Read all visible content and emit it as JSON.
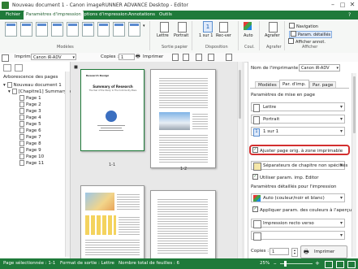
{
  "window": {
    "title": "Nouveau document 1 - Canon imageRUNNER ADVANCE Desktop - Editor"
  },
  "tabs": [
    {
      "label": "Fichier"
    },
    {
      "label": "Paramètres d'impression"
    },
    {
      "label": "Options d'impression"
    },
    {
      "label": "Annotations"
    },
    {
      "label": "Outils"
    }
  ],
  "ribbon": {
    "models_label": "Modèles",
    "sortie_papier_label": "Sortie papier",
    "disposition_label": "Disposition",
    "coul_label": "Coul.",
    "agrafer_group_label": "Agrafer",
    "afficher_label": "Afficher",
    "lettre": "Lettre",
    "portrait": "Portrait",
    "un_sur_un": "1 sur 1",
    "recto_verso": "Rec-ver",
    "auto": "Auto",
    "agrafer": "Agrafer",
    "navigation": "Navigation",
    "param_details": "Param. détaillés",
    "afficher_annot": "Afficher annot."
  },
  "toolbar": {
    "imprim_label": "Imprim :",
    "printer": "Canon iR-ADV",
    "copies_label": "Copies :",
    "copies_value": "1",
    "print_button": "Imprimer"
  },
  "tree": {
    "header": "Arborescence des pages",
    "root": "Nouveau document 1",
    "chapter": "[Chapitre1] Summary o",
    "pages": [
      "Page 1",
      "Page 2",
      "Page 3",
      "Page 4",
      "Page 5",
      "Page 6",
      "Page 7",
      "Page 8",
      "Page 9",
      "Page 10",
      "Page 11"
    ]
  },
  "pages": {
    "p1_header": "Research Design",
    "p1_title": "Summary of Research",
    "p1_subtitle": "The Year of the Study: In The Community Plans",
    "label_1_1": "1-1",
    "label_1_2": "1-2"
  },
  "right": {
    "printer_label": "Nom de l'imprimante :",
    "printer_value": "Canon iR-ADV",
    "tabs": [
      "Modèles",
      "Par. d'imp.",
      "Par. page"
    ],
    "mise_en_page_header": "Paramètres de mise en page",
    "format": "Lettre",
    "orientation": "Portrait",
    "disposition": "1 sur 1",
    "ajuster": "Ajuster page orig. à zone imprimable",
    "separateurs": "Séparateurs de chapitre non spécifiés",
    "utiliser_param": "Utiliser param. imp. Editor",
    "details_header": "Paramètres détaillés pour l'impression",
    "couleur": "Auto (couleur/noir et blanc)",
    "appliquer": "Appliquer param. des couleurs à l'aperçu",
    "recto_verso": "Impression recto verso",
    "copies_label": "Copies :",
    "copies_value": "1",
    "print_button": "Imprimer"
  },
  "status": {
    "page_selected": "Page sélectionnée : 1-1",
    "output_format": "Format de sortie : Lettre",
    "total_sheets": "Nombre total de feuilles : 6",
    "zoom": "25%"
  }
}
